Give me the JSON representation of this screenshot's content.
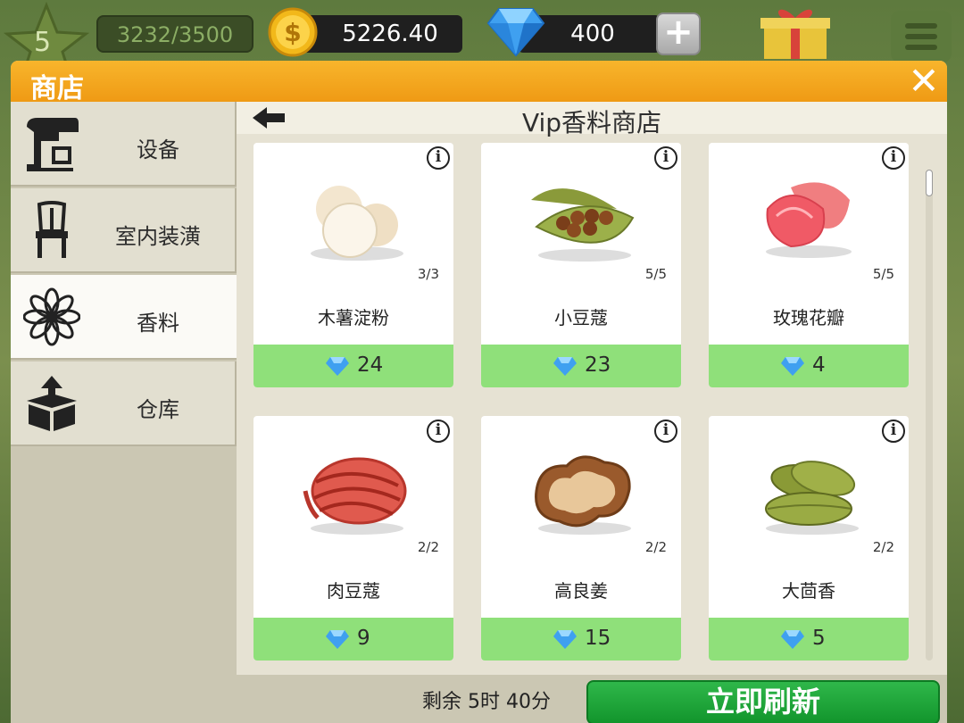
{
  "hud": {
    "level": "5",
    "xp": "3232/3500",
    "coins": "5226.40",
    "gems": "400",
    "add_label": "+",
    "coin_icon": "gold-coin-icon",
    "gem_icon": "blue-diamond-icon"
  },
  "shop": {
    "title": "商店",
    "close_label": "✕",
    "sidebar": [
      {
        "label": "设备",
        "icon": "mixer-icon"
      },
      {
        "label": "室内装潢",
        "icon": "chair-icon"
      },
      {
        "label": "香料",
        "icon": "anise-star-icon",
        "active": true
      },
      {
        "label": "仓库",
        "icon": "box-icon"
      }
    ],
    "subtitle": "Vip香料商店",
    "items": [
      {
        "name": "木薯淀粉",
        "count": "3/3",
        "price": "24"
      },
      {
        "name": "小豆蔻",
        "count": "5/5",
        "price": "23"
      },
      {
        "name": "玫瑰花瓣",
        "count": "5/5",
        "price": "4"
      },
      {
        "name": "肉豆蔻",
        "count": "2/2",
        "price": "9"
      },
      {
        "name": "高良姜",
        "count": "2/2",
        "price": "15"
      },
      {
        "name": "大茴香",
        "count": "2/2",
        "price": "5"
      }
    ],
    "remaining": "剩余 5时 40分",
    "refresh_label": "立即刷新"
  },
  "colors": {
    "header_orange": "#f3a51f",
    "price_green": "#8fe07a",
    "refresh_green": "#1ea63a"
  }
}
